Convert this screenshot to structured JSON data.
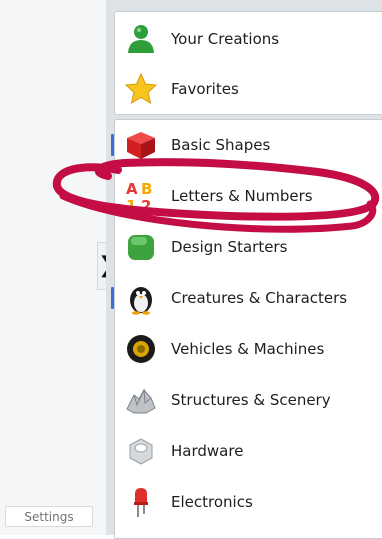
{
  "settings_label": "Settings",
  "collapse_glyph": "❯",
  "top_items": [
    {
      "label": "Your Creations",
      "icon": "person-icon"
    },
    {
      "label": "Favorites",
      "icon": "star-icon"
    }
  ],
  "categories": [
    {
      "label": "Basic Shapes",
      "icon": "red-cube-icon",
      "marker": true
    },
    {
      "label": "Letters & Numbers",
      "icon": "letters-numbers-icon",
      "marker": false
    },
    {
      "label": "Design Starters",
      "icon": "green-box-icon",
      "marker": false
    },
    {
      "label": "Creatures & Characters",
      "icon": "penguin-icon",
      "marker": true
    },
    {
      "label": "Vehicles & Machines",
      "icon": "tire-icon",
      "marker": false
    },
    {
      "label": "Structures & Scenery",
      "icon": "rock-icon",
      "marker": false
    },
    {
      "label": "Hardware",
      "icon": "hex-nut-icon",
      "marker": false
    },
    {
      "label": "Electronics",
      "icon": "led-icon",
      "marker": false
    }
  ],
  "colors": {
    "accent_marker": "#3a6fd6",
    "annotation_ink": "#c40d45"
  }
}
